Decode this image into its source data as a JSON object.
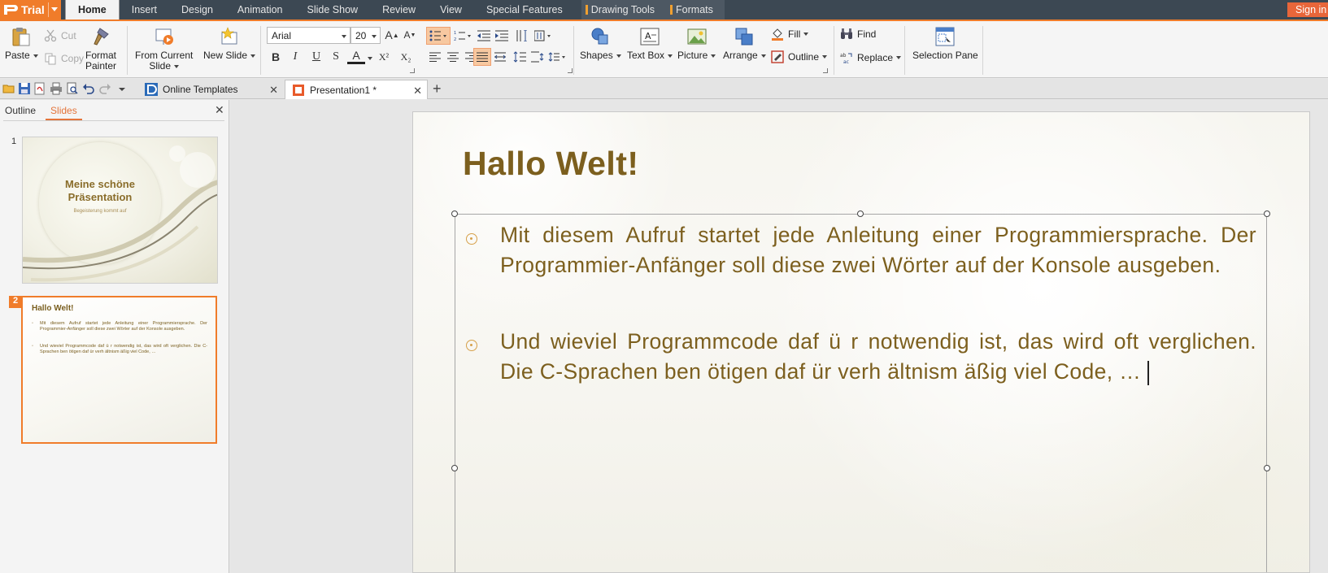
{
  "app": {
    "name": "Trial",
    "sign_in": "Sign in"
  },
  "menu": {
    "tabs": [
      "Home",
      "Insert",
      "Design",
      "Animation",
      "Slide Show",
      "Review",
      "View",
      "Special Features"
    ],
    "context_tabs": [
      "Drawing Tools",
      "Formats"
    ],
    "active": "Home"
  },
  "ribbon": {
    "paste": "Paste",
    "cut": "Cut",
    "copy": "Copy",
    "format_painter": [
      "Format",
      "Painter"
    ],
    "from_current_slide": [
      "From Current",
      "Slide"
    ],
    "new_slide": "New Slide",
    "font_name": "Arial",
    "font_size": "20",
    "shapes": "Shapes",
    "text_box": "Text Box",
    "picture": "Picture",
    "arrange": "Arrange",
    "fill": "Fill",
    "outline": "Outline",
    "find": "Find",
    "replace": "Replace",
    "selection_pane": "Selection Pane",
    "format_labels": {
      "bold": "B",
      "italic": "I",
      "underline": "U",
      "shadow": "S",
      "font_color": "A",
      "superscript": "X²",
      "subscript": "X₂"
    }
  },
  "doc_tabs": [
    {
      "label": "Online Templates",
      "active": false
    },
    {
      "label": "Presentation1 *",
      "active": true
    }
  ],
  "panel": {
    "tabs": [
      "Outline",
      "Slides"
    ],
    "active": "Slides",
    "slides": [
      {
        "number": "1",
        "title": "Meine schöne Präsentation",
        "subtitle": "Begeisterung kommt auf"
      },
      {
        "number": "2",
        "title": "Hallo Welt!",
        "bullets": [
          "Mit diesem Aufruf startet jede Anleitung einer Programmiersprache. Der Programmier-Anfänger soll diese zwei Wörter auf der Konsole ausgeben.",
          "Und wieviel Programmcode daf ü r notwendig ist, das wird oft verglichen. Die C-Sprachen ben ötigen daf ür verh ältnism äßig viel Code, …"
        ]
      }
    ]
  },
  "slide": {
    "title": "Hallo Welt!",
    "paragraphs": [
      "Mit diesem Aufruf startet jede Anleitung einer Programmiersprache. Der Programmier-Anfänger soll diese zwei Wörter auf der Konsole ausgeben.",
      "Und wieviel Programmcode daf ü r notwendig ist, das wird oft verglichen. Die C-Sprachen ben ötigen daf ür verh ältnism äßig viel Code, …"
    ]
  },
  "colors": {
    "accent": "#f07c2a",
    "menubar": "#3c4853",
    "slide_text": "#7c5f1e"
  }
}
